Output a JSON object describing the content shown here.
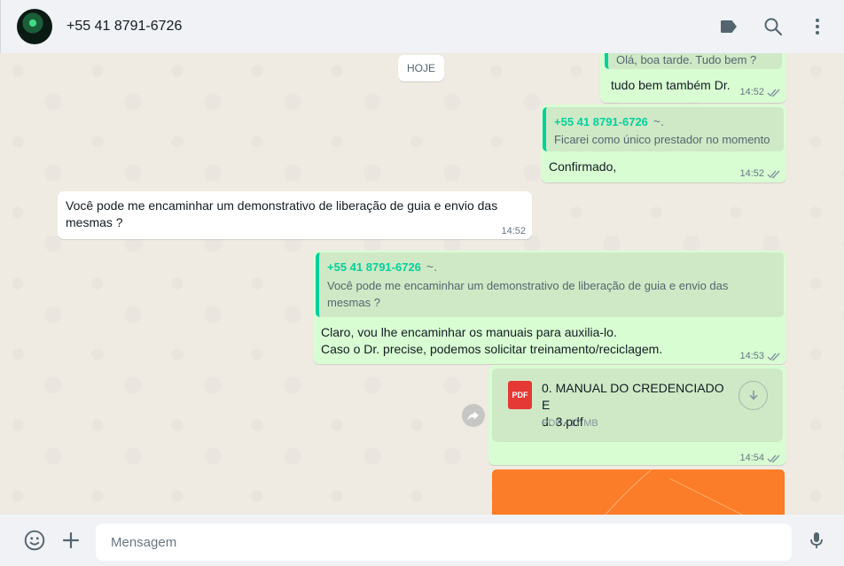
{
  "header": {
    "contact_name": "+55 41 8791-6726",
    "icons": [
      "label-icon",
      "search-icon",
      "menu-icon"
    ]
  },
  "chat": {
    "date_chip": "HOJE",
    "messages": [
      {
        "direction": "out",
        "quote_text": "Olá, boa tarde. Tudo bem ?",
        "text": "tudo bem também Dr.",
        "time": "14:52",
        "status": "read"
      },
      {
        "direction": "out",
        "quote_author": "+55 41 8791-6726",
        "quote_suffix": "~.",
        "quote_text": "Ficarei como único prestador no momento",
        "text": "Confirmado,",
        "time": "14:52",
        "status": "read"
      },
      {
        "direction": "in",
        "text_line1": "Você pode me encaminhar um demonstrativo de liberação de guia e envio das",
        "text_line2": "mesmas ?",
        "time": "14:52"
      },
      {
        "direction": "out",
        "quote_author": "+55 41 8791-6726",
        "quote_suffix": "~.",
        "quote_line1": "Você pode me encaminhar um demonstrativo de liberação de guia e envio das",
        "quote_line2": "mesmas ?",
        "text_line1": "Claro, vou lhe encaminhar os manuais para auxilia-lo.",
        "text_line2": "Caso o Dr. precise, podemos solicitar treinamento/reciclagem.",
        "time": "14:53",
        "status": "read"
      },
      {
        "direction": "out",
        "type": "document",
        "file_icon_label": "PDF",
        "file_name_line1": "0. MANUAL DO CREDENCIADO E",
        "file_name_line2": "d. 3.pdf",
        "file_info": "PDF • 17 MB",
        "time": "14:54",
        "status": "read"
      },
      {
        "direction": "out",
        "type": "image",
        "color": "#fb7c29"
      }
    ]
  },
  "footer": {
    "placeholder": "Mensagem",
    "icons": [
      "emoji-icon",
      "attach-plus-icon",
      "microphone-icon"
    ]
  },
  "colors": {
    "outgoing_bubble": "#d9fdd3",
    "incoming_bubble": "#ffffff",
    "quote_accent": "#06cf9c",
    "chat_background": "#efeae2"
  }
}
